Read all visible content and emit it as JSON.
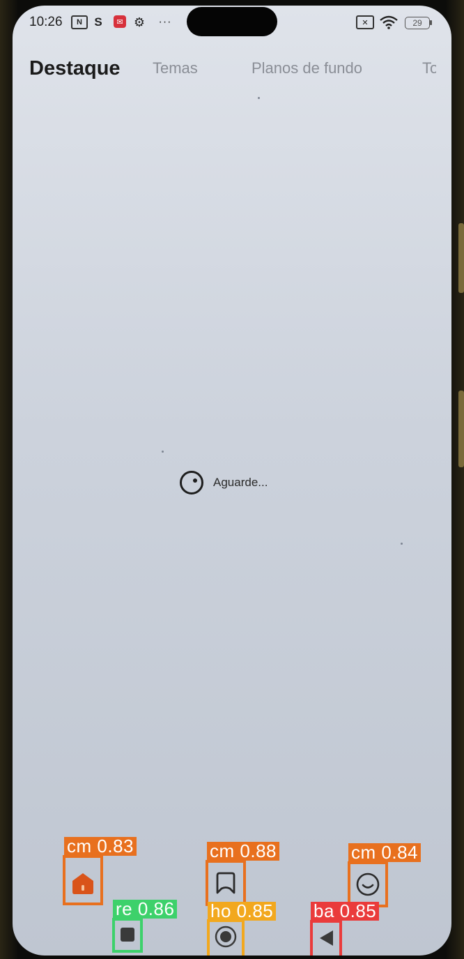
{
  "status_bar": {
    "time": "10:26",
    "nfc_icon": "N",
    "s_icon": "S",
    "battery_level": "29"
  },
  "tabs": [
    {
      "label": "Destaque",
      "active": true
    },
    {
      "label": "Temas",
      "active": false
    },
    {
      "label": "Planos de fundo",
      "active": false
    },
    {
      "label": "To",
      "active": false
    }
  ],
  "loading": {
    "text": "Aguarde..."
  },
  "detections": [
    {
      "label": "cm 0.83",
      "icon": "home-theme-icon",
      "color": "#e8701e"
    },
    {
      "label": "cm 0.88",
      "icon": "bookmark-icon",
      "color": "#e8701e"
    },
    {
      "label": "cm 0.84",
      "icon": "smiley-icon",
      "color": "#e8701e"
    },
    {
      "label": "re 0.86",
      "icon": "recents-square-icon",
      "color": "#3dd16b"
    },
    {
      "label": "ho 0.85",
      "icon": "home-circle-icon",
      "color": "#f2a81e"
    },
    {
      "label": "ba 0.85",
      "icon": "back-triangle-icon",
      "color": "#ea3b3b"
    }
  ],
  "colors": {
    "screen_bg": "#ccd2dc",
    "active_tab": "#1b1b1b",
    "inactive_tab": "#8a8e96",
    "home_icon": "#d9541a"
  }
}
